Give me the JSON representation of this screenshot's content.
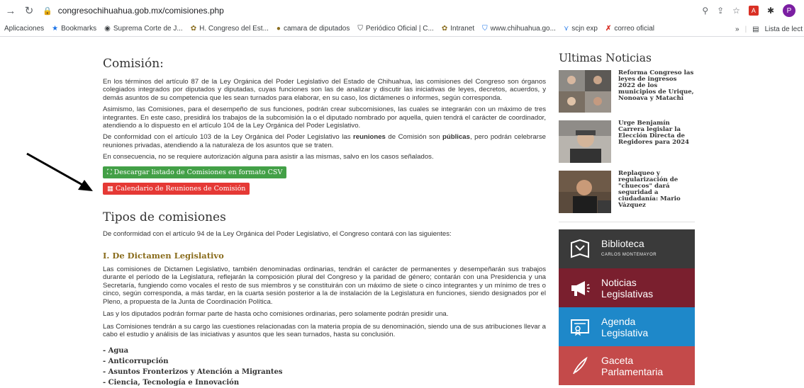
{
  "browser": {
    "url": "congresochihuahua.gob.mx/comisiones.php",
    "bookmarks": [
      {
        "label": "Aplicaciones",
        "icon": "apps-icon"
      },
      {
        "label": "Bookmarks",
        "icon": "star-icon"
      },
      {
        "label": "Suprema Corte de J...",
        "icon": "globe-icon"
      },
      {
        "label": "H. Congreso del Est...",
        "icon": "congress-icon"
      },
      {
        "label": "camara de diputados",
        "icon": "camara-icon"
      },
      {
        "label": "Periódico Oficial | C...",
        "icon": "shield-icon"
      },
      {
        "label": "Intranet",
        "icon": "congress-icon"
      },
      {
        "label": "www.chihuahua.go...",
        "icon": "shield-icon"
      },
      {
        "label": "scjn exp",
        "icon": "scjn-icon"
      },
      {
        "label": "correo oficial",
        "icon": "x-icon"
      }
    ],
    "overflow": "»",
    "reading_list": "Lista de lect",
    "avatar_letter": "P"
  },
  "main": {
    "heading": "Comisión:",
    "p1": "En los términos del artículo 87 de la Ley Orgánica del Poder Legislativo del Estado de Chihuahua, las comisiones del Congreso son órganos colegiados integrados por diputados y diputadas, cuyas funciones son las de analizar y discutir las iniciativas de leyes, decretos, acuerdos, y demás asuntos de su competencia que les sean turnados para elaborar, en su caso, los dictámenes o informes, según corresponda.",
    "p2": "Asimismo, las Comisiones, para el desempeño de sus funciones, podrán crear subcomisiones, las cuales se integrarán con un máximo de tres integrantes. En este caso, presidirá los trabajos de la subcomisión la o el diputado nombrado por aquella, quien tendrá el carácter de coordinador, atendiendo a lo dispuesto en el artículo 104 de la Ley Orgánica del Poder Legislativo.",
    "p3_a": "De conformidad con el artículo 103 de la Ley Orgánica del Poder Legislativo las ",
    "p3_b1": "reuniones",
    "p3_c": " de Comisión son ",
    "p3_b2": "públicas",
    "p3_d": ", pero podrán celebrarse reuniones privadas, atendiendo a la naturaleza de los asuntos que se traten.",
    "p4": "En consecuencia, no se requiere autorización alguna para asistir a las mismas, salvo en los casos señalados.",
    "btn_csv": "Descargar listado de Comisiones en formato CSV",
    "btn_calendar": "Calendario de Reuniones de Comisión",
    "tipos_heading": "Tipos de comisiones",
    "tipos_intro": "De conformidad con el artículo 94 de la Ley Orgánica del Poder Legislativo, el Congreso contará con las siguientes:",
    "dictamen_heading": "I. De Dictamen Legislativo",
    "d1": "Las comisiones de Dictamen Legislativo, también denominadas ordinarias, tendrán el carácter de permanentes y desempeñarán sus trabajos durante el período de la Legislatura, reflejarán la composición plural del Congreso y la paridad de género; contarán con una Presidencia y una Secretaría, fungiendo como vocales el resto de sus miembros y se constituirán con un máximo de siete o cinco integrantes y un mínimo de tres o cinco, según corresponda, a más tardar, en la cuarta sesión posterior a la de instalación de la Legislatura en funciones, siendo designados por el Pleno, a propuesta de la Junta de Coordinación Política.",
    "d2": "Las y los diputados podrán formar parte de hasta ocho comisiones ordinarias, pero solamente podrán presidir una.",
    "d3": "Las Comisiones tendrán a su cargo las cuestiones relacionadas con la materia propia de su denominación, siendo una de sus atribuciones llevar a cabo el estudio y análisis de las iniciativas y asuntos que les sean turnados, hasta su conclusión.",
    "list": [
      "- Agua",
      "- Anticorrupción",
      "- Asuntos Fronterizos y Atención a Migrantes",
      "- Ciencia, Tecnología e Innovación"
    ]
  },
  "sidebar": {
    "heading": "Ultimas Noticias",
    "news": [
      {
        "title": "Reforma Congreso las leyes de ingresos 2022 de los municipios de Urique, Nonoava y Matachí"
      },
      {
        "title": "Urge Benjamín Carrera legislar la Elección Directa de Regidores para 2024"
      },
      {
        "title": "Replaqueo y regularización de \"chuecos\" dará seguridad a ciudadanía: Mario Vázquez"
      }
    ],
    "banners": [
      {
        "line1": "Biblioteca",
        "line2": "CARLOS MONTEMAYOR"
      },
      {
        "line1": "Noticias",
        "line2": "Legislativas"
      },
      {
        "line1": "Agenda",
        "line2": "Legislativa"
      },
      {
        "line1": "Gaceta",
        "line2": "Parlamentaria"
      }
    ]
  }
}
